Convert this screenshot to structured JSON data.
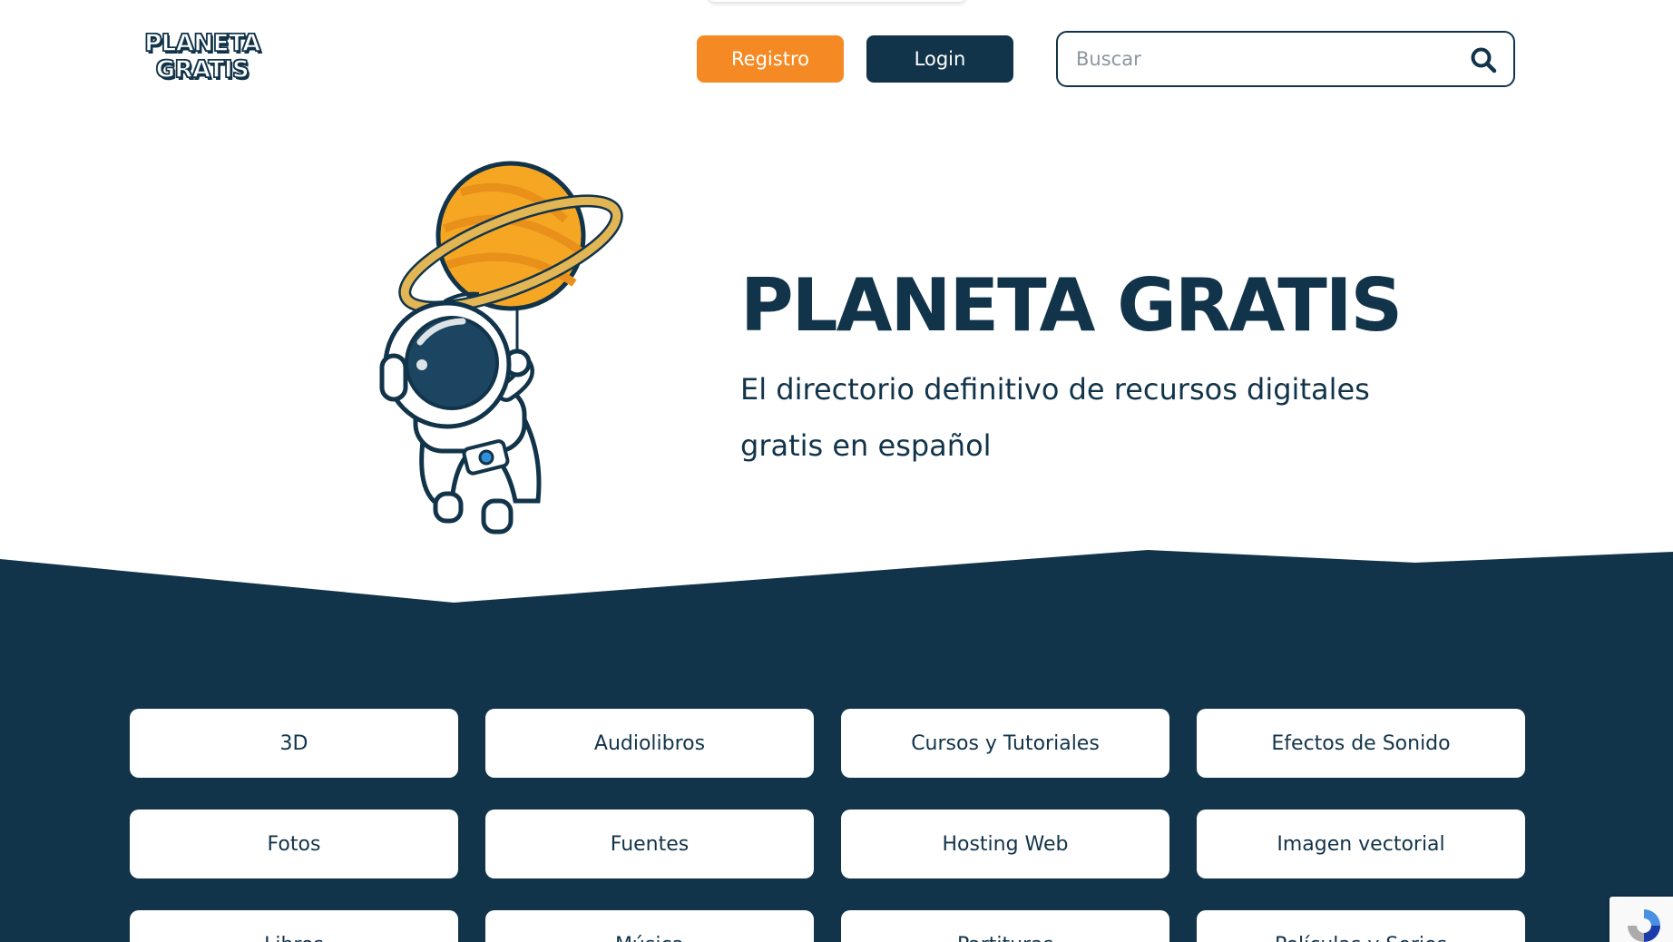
{
  "header": {
    "logo_line1": "PLANETA",
    "logo_line2": "GRATIS",
    "register_label": "Registro",
    "login_label": "Login",
    "search_placeholder": "Buscar",
    "search_icon": "search-icon"
  },
  "hero": {
    "title": "PLANETA GRATIS",
    "subtitle": "El directorio definitivo de recursos digitales gratis en español",
    "illustration": "astronaut-with-planet-balloon"
  },
  "categories": [
    {
      "label": "3D"
    },
    {
      "label": "Audiolibros"
    },
    {
      "label": "Cursos y Tutoriales"
    },
    {
      "label": "Efectos de Sonido"
    },
    {
      "label": "Fotos"
    },
    {
      "label": "Fuentes"
    },
    {
      "label": "Hosting Web"
    },
    {
      "label": "Imagen vectorial"
    },
    {
      "label": "Libros"
    },
    {
      "label": "Música"
    },
    {
      "label": "Partituras"
    },
    {
      "label": "Películas y Series"
    }
  ],
  "colors": {
    "navy": "#12344a",
    "orange": "#f58a24",
    "white": "#ffffff"
  }
}
